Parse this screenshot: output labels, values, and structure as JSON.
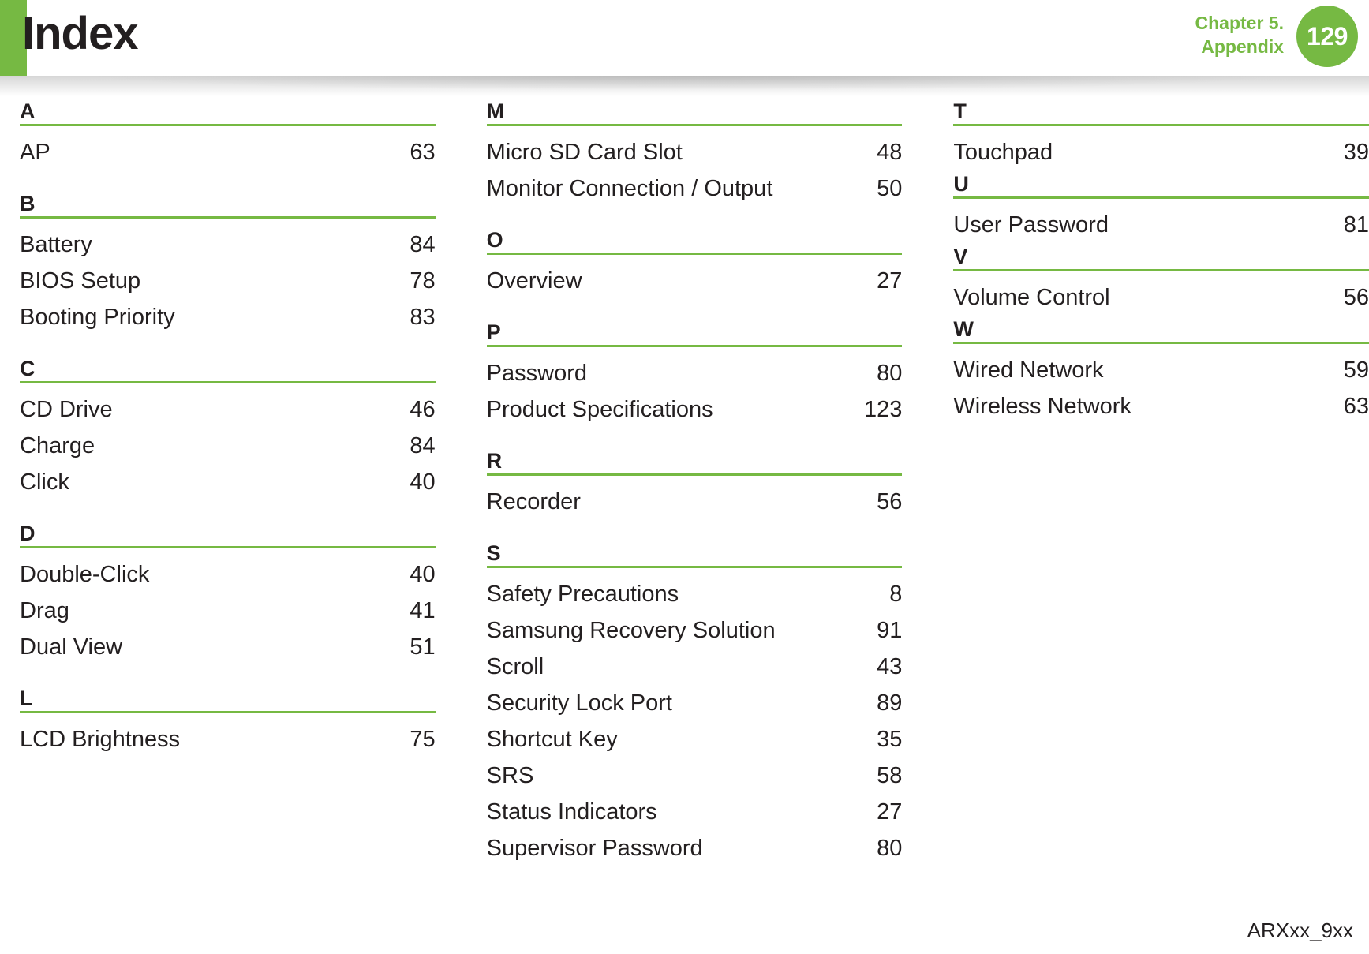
{
  "header": {
    "title": "Index",
    "chapter_line1": "Chapter 5.",
    "chapter_line2": "Appendix",
    "page_number": "129",
    "accent_color": "#76b943"
  },
  "footer": {
    "model_code": "ARXxx_9xx"
  },
  "columns": [
    {
      "sections": [
        {
          "letter": "A",
          "entries": [
            {
              "label": "AP",
              "page": "63"
            }
          ]
        },
        {
          "letter": "B",
          "entries": [
            {
              "label": "Battery",
              "page": "84"
            },
            {
              "label": "BIOS Setup",
              "page": "78"
            },
            {
              "label": "Booting Priority",
              "page": "83"
            }
          ]
        },
        {
          "letter": "C",
          "entries": [
            {
              "label": "CD Drive",
              "page": "46"
            },
            {
              "label": "Charge",
              "page": "84"
            },
            {
              "label": "Click",
              "page": "40"
            }
          ]
        },
        {
          "letter": "D",
          "entries": [
            {
              "label": "Double-Click",
              "page": "40"
            },
            {
              "label": "Drag",
              "page": "41"
            },
            {
              "label": "Dual View",
              "page": "51"
            }
          ]
        },
        {
          "letter": "L",
          "entries": [
            {
              "label": "LCD Brightness",
              "page": "75"
            }
          ]
        }
      ]
    },
    {
      "sections": [
        {
          "letter": "M",
          "entries": [
            {
              "label": "Micro SD Card Slot",
              "page": "48"
            },
            {
              "label": "Monitor Connection / Output",
              "page": "50"
            }
          ]
        },
        {
          "letter": "O",
          "entries": [
            {
              "label": "Overview",
              "page": "27"
            }
          ]
        },
        {
          "letter": "P",
          "entries": [
            {
              "label": "Password",
              "page": "80"
            },
            {
              "label": "Product Specifications",
              "page": "123"
            }
          ]
        },
        {
          "letter": "R",
          "entries": [
            {
              "label": "Recorder",
              "page": "56"
            }
          ]
        },
        {
          "letter": "S",
          "entries": [
            {
              "label": "Safety Precautions",
              "page": "8"
            },
            {
              "label": "Samsung Recovery Solution",
              "page": "91"
            },
            {
              "label": "Scroll",
              "page": "43"
            },
            {
              "label": "Security Lock Port",
              "page": "89"
            },
            {
              "label": "Shortcut Key",
              "page": "35"
            },
            {
              "label": "SRS",
              "page": "58"
            },
            {
              "label": "Status Indicators",
              "page": "27"
            },
            {
              "label": "Supervisor Password",
              "page": "80"
            }
          ]
        }
      ]
    },
    {
      "sections": [
        {
          "letter": "T",
          "entries": [
            {
              "label": "Touchpad",
              "page": "39"
            }
          ]
        },
        {
          "letter": "U",
          "entries": [
            {
              "label": "User Password",
              "page": "81"
            }
          ]
        },
        {
          "letter": "V",
          "entries": [
            {
              "label": "Volume Control",
              "page": "56"
            }
          ]
        },
        {
          "letter": "W",
          "entries": [
            {
              "label": "Wired Network",
              "page": "59"
            },
            {
              "label": "Wireless Network",
              "page": "63"
            }
          ]
        }
      ]
    }
  ]
}
